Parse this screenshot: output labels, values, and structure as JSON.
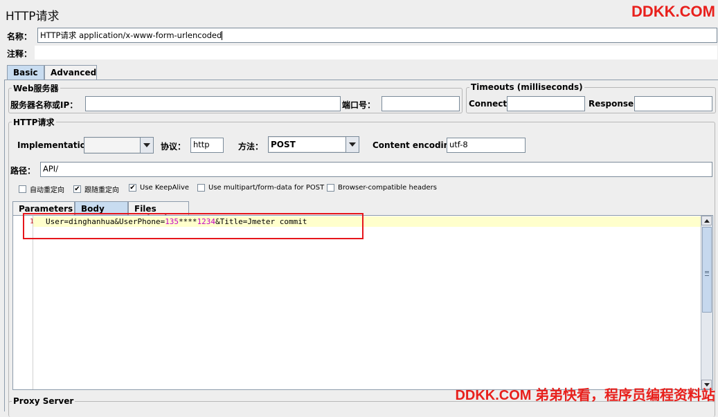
{
  "window": {
    "title": "HTTP请求"
  },
  "watermark": {
    "top": "DDKK.COM",
    "bottom": "DDKK.COM 弟弟快看，程序员编程资料站"
  },
  "name_row": {
    "label": "名称：",
    "value": "HTTP请求  application/x-www-form-urlencoded"
  },
  "comment_row": {
    "label": "注释：",
    "value": ""
  },
  "tabs": [
    {
      "label": "Basic",
      "active": true
    },
    {
      "label": "Advanced",
      "active": false
    }
  ],
  "web_server": {
    "legend": "Web服务器",
    "server_label": "服务器名称或IP：",
    "server_value": "",
    "port_label": "端口号：",
    "port_value": ""
  },
  "timeouts": {
    "legend": "Timeouts (milliseconds)",
    "connect_label": "Connect:",
    "connect_value": "",
    "response_label": "Response:",
    "response_value": ""
  },
  "http_request": {
    "legend": "HTTP请求",
    "implementation_label": "Implementation:",
    "implementation_value": "",
    "protocol_label": "协议：",
    "protocol_value": "http",
    "method_label": "方法：",
    "method_value": "POST",
    "encoding_label": "Content encoding:",
    "encoding_value": "utf-8",
    "path_label": "路径：",
    "path_value": "API/"
  },
  "checkboxes": [
    {
      "label": "自动重定向",
      "checked": false
    },
    {
      "label": "跟随重定向",
      "checked": true
    },
    {
      "label": "Use KeepAlive",
      "checked": true
    },
    {
      "label": "Use multipart/form-data for POST",
      "checked": false
    },
    {
      "label": "Browser-compatible headers",
      "checked": false
    }
  ],
  "sub_tabs": [
    {
      "label": "Parameters",
      "active": false
    },
    {
      "label": "Body Data",
      "active": true
    },
    {
      "label": "Files Upload",
      "active": false
    }
  ],
  "body_data": {
    "line_number": "1",
    "text": "User=dinghanhua&UserPhone=135****1234&Title=Jmeter commit",
    "parts": [
      {
        "t": "User=dinghanhua&UserPhone=",
        "num": false
      },
      {
        "t": "135",
        "num": true
      },
      {
        "t": "****",
        "num": false
      },
      {
        "t": "1234",
        "num": true
      },
      {
        "t": "&Title=Jmeter commit",
        "num": false
      }
    ]
  },
  "proxy": {
    "legend": "Proxy Server"
  },
  "colors": {
    "accent_tab": "#c8dcf0",
    "highlight_line": "#ffffcc",
    "annotation_red": "#e6151b",
    "watermark": "#e8201c",
    "number_token": "#c400c4"
  }
}
